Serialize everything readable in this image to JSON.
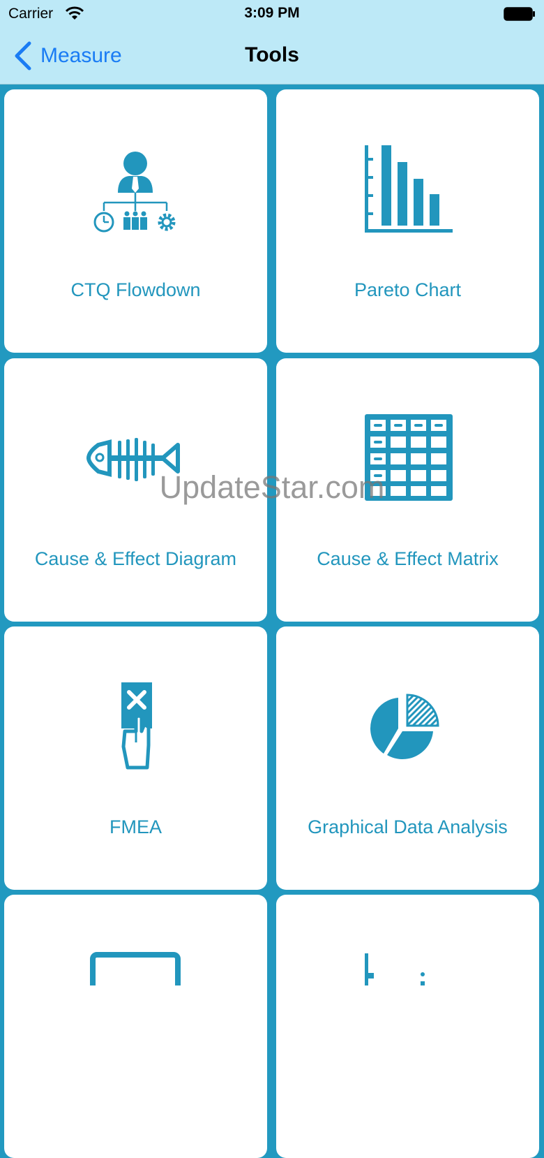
{
  "status_bar": {
    "carrier": "Carrier",
    "time": "3:09 PM"
  },
  "nav": {
    "back_label": "Measure",
    "title": "Tools"
  },
  "tiles": [
    {
      "label": "CTQ Flowdown",
      "icon": "org-chart-icon"
    },
    {
      "label": "Pareto Chart",
      "icon": "pareto-chart-icon"
    },
    {
      "label": "Cause & Effect Diagram",
      "icon": "fishbone-icon"
    },
    {
      "label": "Cause & Effect Matrix",
      "icon": "matrix-grid-icon"
    },
    {
      "label": "FMEA",
      "icon": "failure-card-icon"
    },
    {
      "label": "Graphical Data Analysis",
      "icon": "pie-chart-icon"
    }
  ],
  "watermark": "UpdateStar.com",
  "colors": {
    "accent": "#2299c0",
    "nav_bg": "#bde9f7",
    "link": "#1a7cf4"
  }
}
